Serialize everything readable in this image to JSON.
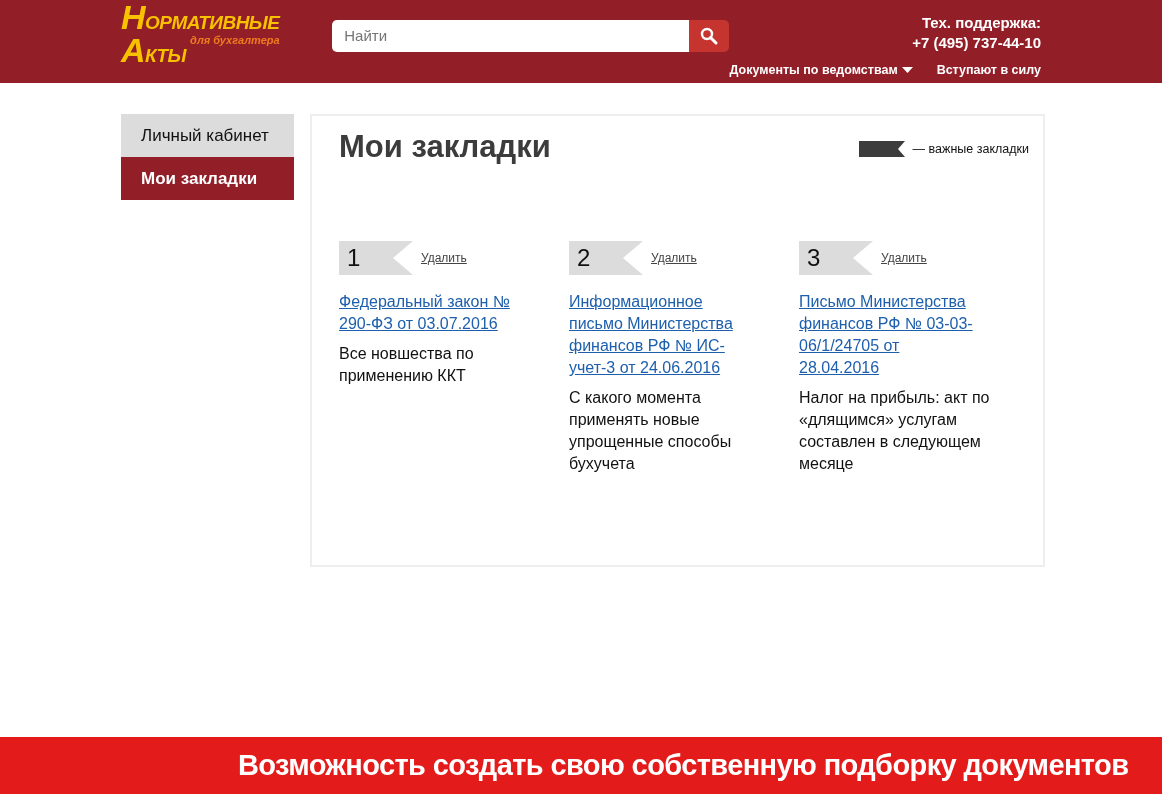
{
  "header": {
    "logo": {
      "line1": "НОРМАТИВНЫЕ",
      "line2": "АКТЫ",
      "tagline": "для бухгалтера"
    },
    "search": {
      "placeholder": "Найти"
    },
    "support": {
      "label": "Тех. поддержка:",
      "phone": "+7 (495) 737-44-10"
    },
    "nav": [
      {
        "label": "Документы по ведомствам",
        "dropdown": true
      },
      {
        "label": "Вступают в силу",
        "dropdown": false
      }
    ]
  },
  "sidebar": {
    "items": [
      {
        "label": "Личный кабинет",
        "selected": false
      },
      {
        "label": "Мои закладки",
        "selected": true
      }
    ]
  },
  "main": {
    "title": "Мои закладки",
    "legend": "— важные закладки",
    "bookmarks": [
      {
        "number": "1",
        "important": false,
        "delete": "Удалить",
        "title": "Федеральный закон № 290-ФЗ от 03.07.2016",
        "description": "Все новшества по применению ККТ"
      },
      {
        "number": "2",
        "important": false,
        "delete": "Удалить",
        "title": "Информационное письмо Министерства финансов РФ № ИС-учет-3 от 24.06.2016",
        "description": "С какого момента применять новые упрощенные способы бухучета"
      },
      {
        "number": "3",
        "important": false,
        "delete": "Удалить",
        "title": "Письмо Министерства финансов РФ № 03-03-06/1/24705 от 28.04.2016",
        "description": "Налог на прибыль: акт по «длящимся» услугам составлен в следующем месяце"
      }
    ]
  },
  "banner": {
    "text": "Возможность создать свою собственную подборку документов"
  }
}
